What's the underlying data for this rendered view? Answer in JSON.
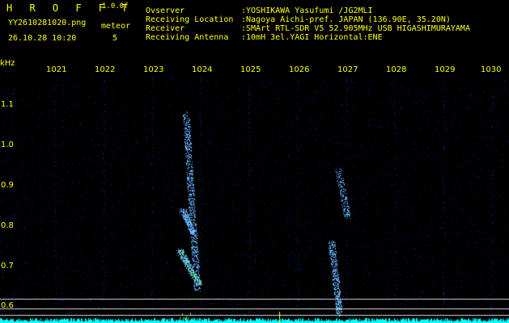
{
  "header": {
    "title": "H R O F F T",
    "version": "1.0.0f",
    "filename": "YY2610281020.png",
    "timestamp": "26.10.28 10:20",
    "meteor_label": "meteor",
    "meteor_count": "5"
  },
  "info": [
    {
      "key": "Ovserver",
      "value": ":YOSHIKAWA Yasufumi /JG2MLI"
    },
    {
      "key": "Receiving Location",
      "value": ":Nagoya Aichi-pref. JAPAN (136.90E, 35.20N)"
    },
    {
      "key": "Receiver",
      "value": ":SMArt RTL-SDR V5 52.905MHz USB HIGASHIMURAYAMA"
    },
    {
      "key": "Receiving Antenna",
      "value": ":10mH 3el.YAGI Horizontal:ENE"
    }
  ],
  "axis": {
    "y_unit": "kHz",
    "y_ticks": [
      "1.1",
      "1.0",
      "0.9",
      "0.8",
      "0.7",
      "0.6"
    ],
    "x_ticks": [
      "1021",
      "1022",
      "1023",
      "1024",
      "1025",
      "1026",
      "1027",
      "1028",
      "1029",
      "1030"
    ]
  },
  "colors": {
    "background": "#000000",
    "text": "#ffff00",
    "noise": "#1a3dff",
    "signal": "#3fd14f",
    "baseline": "#00ffff"
  }
}
